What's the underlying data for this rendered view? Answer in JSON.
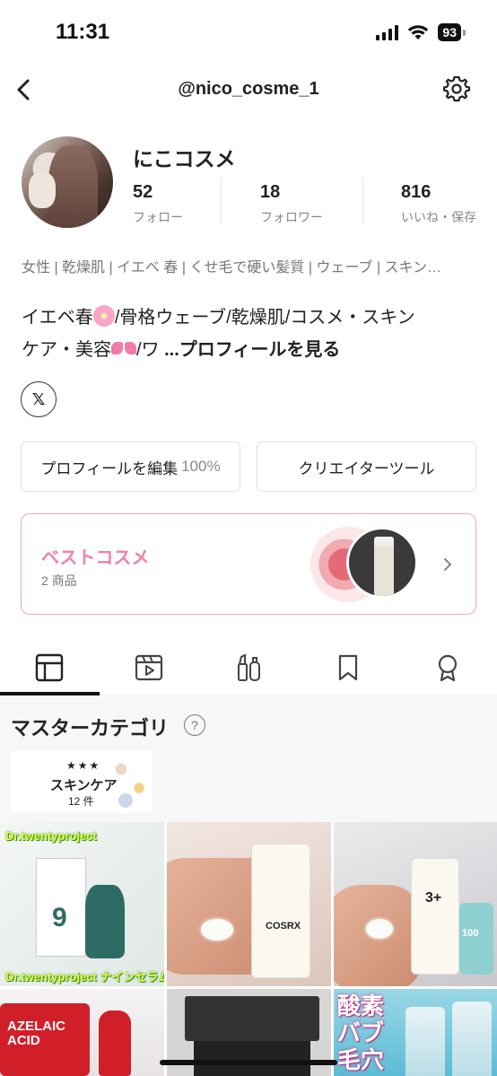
{
  "status_bar": {
    "time": "11:31",
    "battery": "93"
  },
  "nav": {
    "title": "@nico_cosme_1"
  },
  "profile": {
    "name": "にこコスメ",
    "stats": [
      {
        "value": "52",
        "label": "フォロー"
      },
      {
        "value": "18",
        "label": "フォロワー"
      },
      {
        "value": "816",
        "label": "いいね・保存"
      }
    ],
    "tags": "女性 | 乾燥肌 | イエベ 春 | くせ毛で硬い髪質 | ウェーブ | スキン…",
    "bio_part1": "イエベ春",
    "bio_part2": "/骨格ウェーブ/乾燥肌/コスメ・スキン",
    "bio_part3": "ケア・美容",
    "bio_part4": "/ワ ",
    "bio_more": "...プロフィールを見る",
    "x_label": "𝕏"
  },
  "buttons": {
    "edit_profile": "プロフィールを編集",
    "edit_percent": "100%",
    "creator_tools": "クリエイターツール"
  },
  "best_cosme": {
    "title": "ベストコスメ",
    "count": "2 商品"
  },
  "tabs": [
    "grid-icon",
    "video-icon",
    "cosmetics-icon",
    "bookmark-icon",
    "award-icon"
  ],
  "master": {
    "title": "マスターカテゴリ",
    "help": "?",
    "card": {
      "stars": "★★★",
      "label": "スキンケア",
      "count": "12 件"
    }
  },
  "posts": {
    "p1_top": "Dr.twentyproject",
    "p1_bottom": "Dr.twentyproject ナインセラム",
    "p1_num": "9",
    "p2_brand": "COSRX",
    "p3_num": "3+",
    "p3_num2": "100",
    "p4_text": "AZELAIC ACID",
    "p6_text": "酸素バブ 毛穴ス"
  },
  "colors": {
    "accent_pink": "#ef83a5",
    "best_border": "#f0a6be"
  }
}
